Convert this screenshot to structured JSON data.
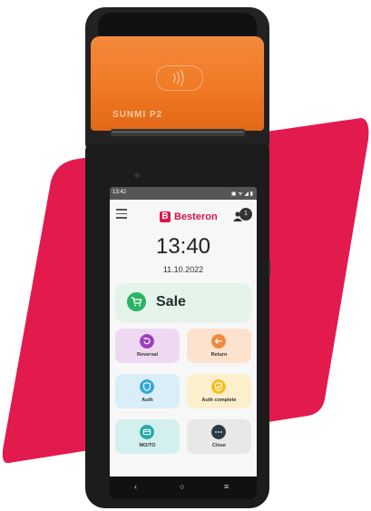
{
  "device": {
    "brand_label": "SUNMI P2",
    "brand_color": "#f07a25",
    "accent_red": "#e31a4d"
  },
  "status_bar": {
    "time": "13:42",
    "right_icons": "▣ ᯤ ◢ ▮"
  },
  "app_bar": {
    "menu_icon": "hamburger-menu-icon",
    "logo_mark": "B",
    "logo_text": "Besteron",
    "notification_count": "1"
  },
  "clock": {
    "time": "13:40",
    "date": "11.10.2022"
  },
  "sale_button": {
    "label": "Sale",
    "icon": "cart-icon",
    "color": "#2bb463"
  },
  "tiles": [
    {
      "label": "Reversal",
      "icon": "reversal-icon",
      "bg": "#efd9f2",
      "color": "#9a3fbf"
    },
    {
      "label": "Return",
      "icon": "return-arrow-icon",
      "bg": "#fde2cd",
      "color": "#f08a3a"
    },
    {
      "label": "Auth",
      "icon": "shield-icon",
      "bg": "#d9eef8",
      "color": "#35a6d8"
    },
    {
      "label": "Auth complete",
      "icon": "shield-check-icon",
      "bg": "#fcf0cc",
      "color": "#f3bf1f"
    },
    {
      "label": "MO/TO",
      "icon": "card-icon",
      "bg": "#d3f0ef",
      "color": "#26a9a6"
    },
    {
      "label": "Close",
      "icon": "more-icon",
      "bg": "#e8e8e8",
      "color": "#2b3a44"
    }
  ],
  "nav_bar": {
    "back": "‹",
    "home": "○",
    "recents": "≡"
  }
}
